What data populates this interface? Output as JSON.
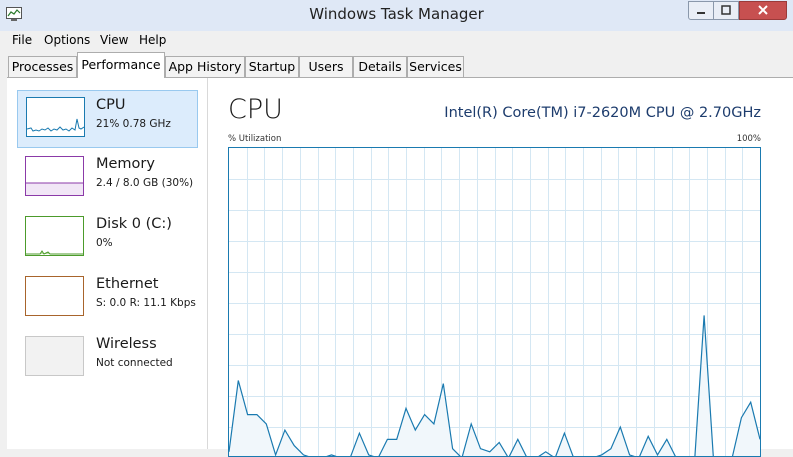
{
  "window": {
    "title": "Windows Task Manager"
  },
  "colors": {
    "cpu": "#1a7ab0",
    "memory": "#8b3aa8",
    "disk": "#4c9b2b",
    "ethernet": "#a8642c",
    "wireless": "#c8c8c8",
    "cpu_model_text": "#1d3c6d"
  },
  "menu": [
    "File",
    "Options",
    "View",
    "Help"
  ],
  "tabs": [
    "Processes",
    "Performance",
    "App History",
    "Startup",
    "Users",
    "Details",
    "Services"
  ],
  "active_tab": "Performance",
  "resources": [
    {
      "name": "CPU",
      "detail": "21%  0.78 GHz",
      "selected": true
    },
    {
      "name": "Memory",
      "detail": "2.4 / 8.0 GB (30%)"
    },
    {
      "name": "Disk 0 (C:)",
      "detail": "0%"
    },
    {
      "name": "Ethernet",
      "detail": "S: 0.0  R: 11.1 Kbps"
    },
    {
      "name": "Wireless",
      "detail": "Not connected"
    }
  ],
  "main": {
    "title": "CPU",
    "cpu_model": "Intel(R) Core(TM) i7-2620M CPU @ 2.70GHz",
    "util_label": "% Utilization",
    "util_max": "100%"
  },
  "cpu_history": [
    2,
    25,
    14,
    14,
    11,
    1,
    9,
    4,
    1,
    0,
    0,
    1,
    0,
    0,
    8,
    1,
    0,
    6,
    6,
    16,
    9,
    14,
    11,
    24,
    3,
    0,
    11,
    3,
    2,
    5,
    0,
    6,
    0,
    0,
    2,
    0,
    8,
    0,
    0,
    0,
    1,
    3,
    10,
    1,
    0,
    7,
    1,
    6,
    0,
    0,
    0,
    46,
    0,
    0,
    0,
    13,
    18,
    6
  ]
}
